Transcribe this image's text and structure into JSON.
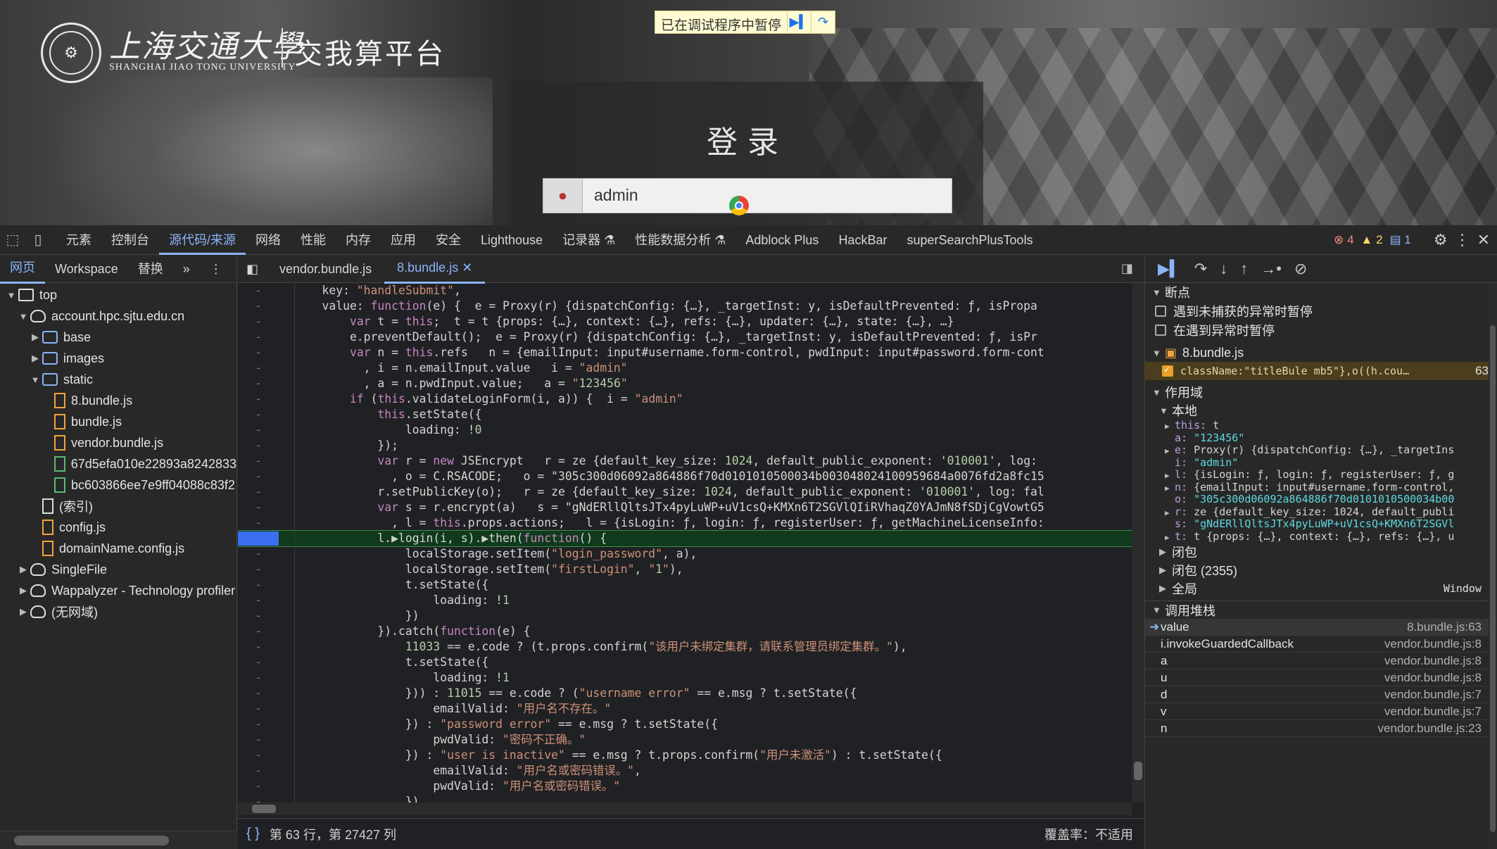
{
  "page": {
    "university_cn": "上海交通大學",
    "university_en": "SHANGHAI JIAO TONG UNIVERSITY",
    "platform_name": "交我算平台",
    "login_title": "登录",
    "username_value": "admin",
    "debug_banner": "已在调试程序中暂停"
  },
  "devtools": {
    "tabs": [
      "元素",
      "控制台",
      "源代码/来源",
      "网络",
      "性能",
      "内存",
      "应用",
      "安全",
      "Lighthouse",
      "记录器 ⚗",
      "性能数据分析 ⚗",
      "Adblock Plus",
      "HackBar",
      "superSearchPlusTools"
    ],
    "active_tab": "源代码/来源",
    "counts": {
      "errors": "4",
      "warnings": "2",
      "messages": "1"
    },
    "navigator_tabs": [
      "网页",
      "Workspace",
      "替换"
    ],
    "tree": [
      {
        "label": "top",
        "depth": 0,
        "arrow": "▼",
        "icon": "window"
      },
      {
        "label": "account.hpc.sjtu.edu.cn",
        "depth": 1,
        "arrow": "▼",
        "icon": "cloud"
      },
      {
        "label": "base",
        "depth": 2,
        "arrow": "▶",
        "icon": "folder"
      },
      {
        "label": "images",
        "depth": 2,
        "arrow": "▶",
        "icon": "folder"
      },
      {
        "label": "static",
        "depth": 2,
        "arrow": "▼",
        "icon": "folder"
      },
      {
        "label": "8.bundle.js",
        "depth": 3,
        "arrow": "",
        "icon": "js"
      },
      {
        "label": "bundle.js",
        "depth": 3,
        "arrow": "",
        "icon": "js"
      },
      {
        "label": "vendor.bundle.js",
        "depth": 3,
        "arrow": "",
        "icon": "js"
      },
      {
        "label": "67d5efa010e22893a8242833",
        "depth": 3,
        "arrow": "",
        "icon": "res"
      },
      {
        "label": "bc603866ee7e9ff04088c83f2",
        "depth": 3,
        "arrow": "",
        "icon": "res"
      },
      {
        "label": "(索引)",
        "depth": 2,
        "arrow": "",
        "icon": "doc"
      },
      {
        "label": "config.js",
        "depth": 2,
        "arrow": "",
        "icon": "js"
      },
      {
        "label": "domainName.config.js",
        "depth": 2,
        "arrow": "",
        "icon": "js"
      },
      {
        "label": "SingleFile",
        "depth": 1,
        "arrow": "▶",
        "icon": "cloud"
      },
      {
        "label": "Wappalyzer - Technology profiler",
        "depth": 1,
        "arrow": "▶",
        "icon": "cloud"
      },
      {
        "label": "(无网域)",
        "depth": 1,
        "arrow": "▶",
        "icon": "cloud"
      }
    ],
    "editor_tabs": [
      "vendor.bundle.js",
      "8.bundle.js"
    ],
    "active_editor_tab": "8.bundle.js",
    "code_lines": [
      {
        "g": "-",
        "t": "    key: \"handleSubmit\","
      },
      {
        "g": "-",
        "t": "    value: function(e) {  e = Proxy(r) {dispatchConfig: {…}, _targetInst: y, isDefaultPrevented: ƒ, isPropa"
      },
      {
        "g": "-",
        "t": "        var t = this;  t = t {props: {…}, context: {…}, refs: {…}, updater: {…}, state: {…}, …}"
      },
      {
        "g": "-",
        "t": "        e.preventDefault();  e = Proxy(r) {dispatchConfig: {…}, _targetInst: y, isDefaultPrevented: ƒ, isPr"
      },
      {
        "g": "-",
        "t": "        var n = this.refs   n = {emailInput: input#username.form-control, pwdInput: input#password.form-cont"
      },
      {
        "g": "-",
        "t": "          , i = n.emailInput.value   i = \"admin\""
      },
      {
        "g": "-",
        "t": "          , a = n.pwdInput.value;   a = \"123456\""
      },
      {
        "g": "-",
        "t": "        if (this.validateLoginForm(i, a)) {  i = \"admin\""
      },
      {
        "g": "-",
        "t": "            this.setState({"
      },
      {
        "g": "-",
        "t": "                loading: !0"
      },
      {
        "g": "-",
        "t": "            });"
      },
      {
        "g": "-",
        "t": "            var r = new JSEncrypt   r = ze {default_key_size: 1024, default_public_exponent: '010001', log:"
      },
      {
        "g": "-",
        "t": "              , o = C.RSACODE;   o = \"305c300d06092a864886f70d0101010500034b003048024100959684a0076fd2a8fc15"
      },
      {
        "g": "-",
        "t": "            r.setPublicKey(o);   r = ze {default_key_size: 1024, default_public_exponent: '010001', log: fal"
      },
      {
        "g": "-",
        "t": "            var s = r.encrypt(a)   s = \"gNdERllQltsJTx4pyLuWP+uV1csQ+KMXn6T2SGVlQIiRVhaqZ0YAJmN8fSDjCgVowtG5"
      },
      {
        "g": "-",
        "t": "              , l = this.props.actions;   l = {isLogin: ƒ, login: ƒ, registerUser: ƒ, getMachineLicenseInfo:"
      },
      {
        "g": "",
        "t": "            l.▶login(i, s).▶then(function() {",
        "paused": true
      },
      {
        "g": "-",
        "t": "                localStorage.setItem(\"login_password\", a),"
      },
      {
        "g": "-",
        "t": "                localStorage.setItem(\"firstLogin\", \"1\"),"
      },
      {
        "g": "-",
        "t": "                t.setState({"
      },
      {
        "g": "-",
        "t": "                    loading: !1"
      },
      {
        "g": "-",
        "t": "                })"
      },
      {
        "g": "-",
        "t": "            }).catch(function(e) {"
      },
      {
        "g": "-",
        "t": "                11033 == e.code ? (t.props.confirm(\"该用户未绑定集群，请联系管理员绑定集群。\"),"
      },
      {
        "g": "-",
        "t": "                t.setState({"
      },
      {
        "g": "-",
        "t": "                    loading: !1"
      },
      {
        "g": "-",
        "t": "                })) : 11015 == e.code ? (\"username error\" == e.msg ? t.setState({"
      },
      {
        "g": "-",
        "t": "                    emailValid: \"用户名不存在。\""
      },
      {
        "g": "-",
        "t": "                }) : \"password error\" == e.msg ? t.setState({"
      },
      {
        "g": "-",
        "t": "                    pwdValid: \"密码不正确。\""
      },
      {
        "g": "-",
        "t": "                }) : \"user is inactive\" == e.msg ? t.props.confirm(\"用户未激活\") : t.setState({"
      },
      {
        "g": "-",
        "t": "                    emailValid: \"用户名或密码错误。\","
      },
      {
        "g": "-",
        "t": "                    pwdValid: \"用户名或密码错误。\""
      },
      {
        "g": "-",
        "t": "                })"
      }
    ],
    "status": {
      "position": "第 63 行，第 27427 列",
      "coverage": "覆盖率：不适用"
    },
    "debugger": {
      "sections": {
        "breakpoints": "断点",
        "pause_uncaught": "遇到未捕获的异常时暂停",
        "pause_caught": "在遇到异常时暂停",
        "bp_file": "8.bundle.js",
        "bp_code": "className:\"titleBule mb5\"},o((h.cou…",
        "bp_line": "63",
        "scope": "作用域",
        "local": "本地",
        "closure": "闭包",
        "closure2": "闭包 (2355)",
        "global": "全局",
        "global_val": "Window",
        "callstack": "调用堆栈"
      },
      "scope_vars": [
        {
          "arrow": "▶",
          "k": "this",
          "v": "t"
        },
        {
          "arrow": "",
          "k": "a",
          "v": "\"123456\"",
          "str": true
        },
        {
          "arrow": "▶",
          "k": "e",
          "v": "Proxy(r) {dispatchConfig: {…}, _targetIns"
        },
        {
          "arrow": "",
          "k": "i",
          "v": "\"admin\"",
          "str": true
        },
        {
          "arrow": "▶",
          "k": "l",
          "v": "{isLogin: ƒ, login: ƒ, registerUser: ƒ, g"
        },
        {
          "arrow": "▶",
          "k": "n",
          "v": "{emailInput: input#username.form-control,"
        },
        {
          "arrow": "",
          "k": "o",
          "v": "\"305c300d06092a864886f70d0101010500034b00",
          "str": true
        },
        {
          "arrow": "▶",
          "k": "r",
          "v": "ze {default_key_size: 1024, default_publi"
        },
        {
          "arrow": "",
          "k": "s",
          "v": "\"gNdERllQltsJTx4pyLuWP+uV1csQ+KMXn6T2SGVl",
          "str": true
        },
        {
          "arrow": "▶",
          "k": "t",
          "v": "t {props: {…}, context: {…}, refs: {…}, u"
        }
      ],
      "call_stack": [
        {
          "fn": "value",
          "loc": "8.bundle.js:63",
          "current": true
        },
        {
          "fn": "i.invokeGuardedCallback",
          "loc": "vendor.bundle.js:8"
        },
        {
          "fn": "a",
          "loc": "vendor.bundle.js:8"
        },
        {
          "fn": "u",
          "loc": "vendor.bundle.js:8"
        },
        {
          "fn": "d",
          "loc": "vendor.bundle.js:7"
        },
        {
          "fn": "v",
          "loc": "vendor.bundle.js:7"
        },
        {
          "fn": "n",
          "loc": "vendor.bundle.js:23"
        }
      ]
    }
  }
}
